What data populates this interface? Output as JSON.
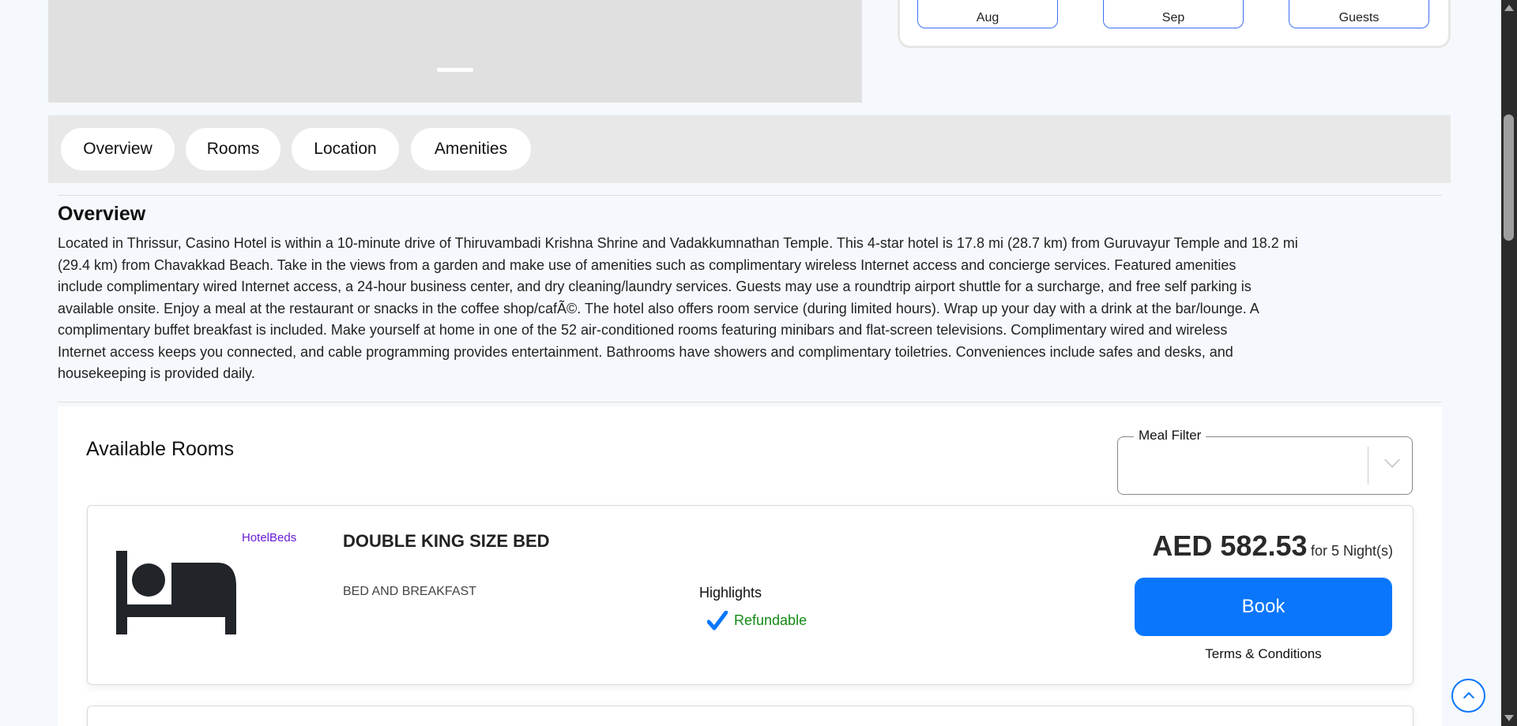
{
  "search": {
    "month_in": "Aug",
    "month_out": "Sep",
    "guests": "Guests"
  },
  "tabs": [
    {
      "label": "Overview"
    },
    {
      "label": "Rooms"
    },
    {
      "label": "Location"
    },
    {
      "label": "Amenities"
    }
  ],
  "overview": {
    "title": "Overview",
    "lines": [
      "Located in Thrissur, Casino Hotel is within a 10-minute drive of Thiruvambadi Krishna Shrine and Vadakkumnathan Temple. This 4-star hotel is 17.8 mi (28.7 km) from Guruvayur Temple and 18.2 mi",
      "(29.4 km) from Chavakkad Beach. Take in the views from a garden and make use of amenities such as complimentary wireless Internet access and concierge services. Featured amenities",
      "include complimentary wired Internet access, a 24-hour business center, and dry cleaning/laundry services. Guests may use a roundtrip airport shuttle for a surcharge, and free self parking is",
      "available onsite. Enjoy a meal at the restaurant or snacks in the coffee shop/cafÃ©. The hotel also offers room service (during limited hours). Wrap up your day with a drink at the bar/lounge. A",
      "complimentary buffet breakfast is included. Make yourself at home in one of the 52 air-conditioned rooms featuring minibars and flat-screen televisions. Complimentary wired and wireless",
      "Internet access keeps you connected, and cable programming provides entertainment. Bathrooms have showers and complimentary toiletries. Conveniences include safes and desks, and",
      "housekeeping is provided daily."
    ]
  },
  "rooms": {
    "title": "Available Rooms",
    "meal_filter_label": "Meal Filter",
    "meal_filter_value": "",
    "items": [
      {
        "supplier": "HotelBeds",
        "name": "DOUBLE KING SIZE BED",
        "board": "BED AND BREAKFAST",
        "highlights_label": "Highlights",
        "highlight": "Refundable",
        "price": "AED 582.53",
        "per": "for 5 Night(s)",
        "book_label": "Book",
        "terms_label": "Terms & Conditions"
      }
    ]
  },
  "colors": {
    "accent": "#0a76fc",
    "supplier": "#6a1bd8",
    "refundable": "#138a13"
  }
}
